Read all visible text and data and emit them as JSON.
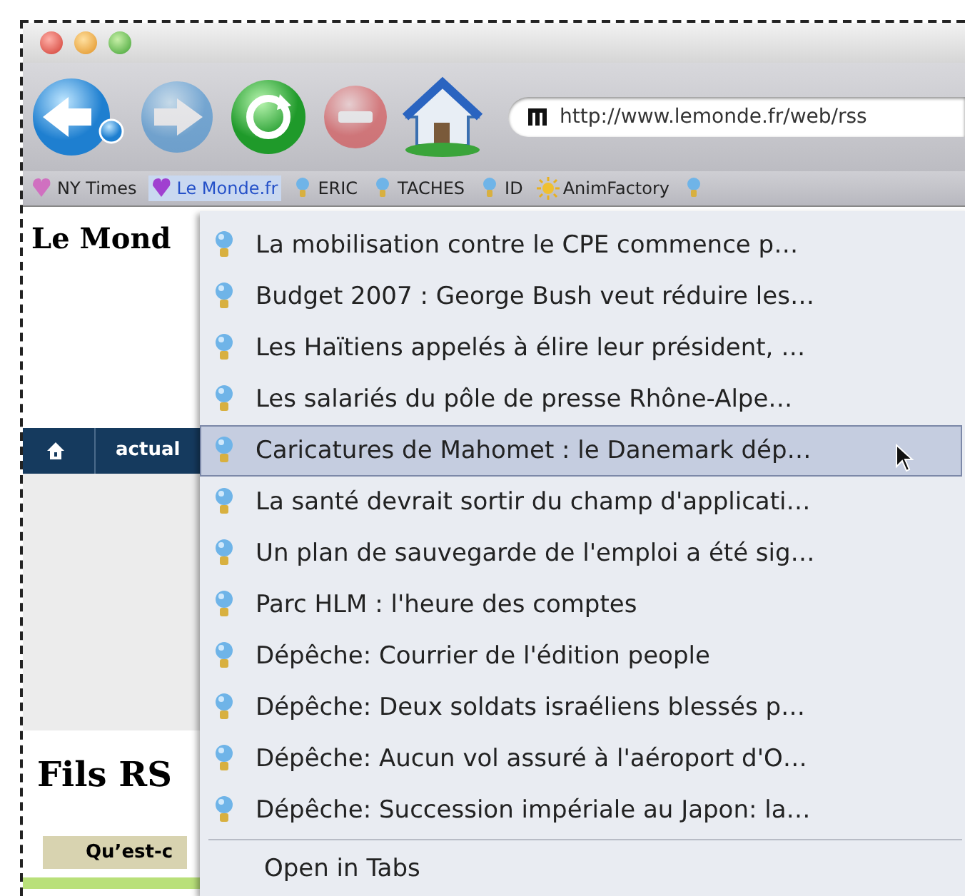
{
  "toolbar": {
    "buttons": [
      {
        "kind": "back",
        "disabled": false
      },
      {
        "kind": "forward",
        "disabled": true
      },
      {
        "kind": "reload",
        "disabled": false
      },
      {
        "kind": "stop",
        "disabled": true
      },
      {
        "kind": "home",
        "disabled": false
      }
    ],
    "url": "http://www.lemonde.fr/web/rss"
  },
  "bookmarks": [
    {
      "label": "NY Times",
      "kind": "heart",
      "selected": false
    },
    {
      "label": "Le Monde.fr",
      "kind": "heart",
      "selected": true
    },
    {
      "label": "ERIC",
      "kind": "feed",
      "selected": false
    },
    {
      "label": "TACHES",
      "kind": "feed",
      "selected": false
    },
    {
      "label": "ID",
      "kind": "feed",
      "selected": false
    },
    {
      "label": "AnimFactory",
      "kind": "sun",
      "selected": false
    },
    {
      "kind": "feed",
      "selected": false
    }
  ],
  "page": {
    "logo": "Le Mond",
    "nav": "actual",
    "heading": "Fils RS",
    "tab": "Qu’est-c"
  },
  "menu": {
    "items": [
      {
        "label": "La mobilisation contre le CPE commence p…",
        "selected": false
      },
      {
        "label": "Budget 2007 : George Bush veut réduire les…",
        "selected": false
      },
      {
        "label": "Les Haïtiens appelés à élire leur président, …",
        "selected": false
      },
      {
        "label": "Les salariés du pôle de presse Rhône-Alpe…",
        "selected": false
      },
      {
        "label": "Caricatures de Mahomet : le Danemark dép…",
        "selected": true
      },
      {
        "label": "La santé devrait sortir du champ d'applicati…",
        "selected": false
      },
      {
        "label": "Un plan de sauvegarde de l'emploi a été sig…",
        "selected": false
      },
      {
        "label": "Parc HLM : l'heure des comptes",
        "selected": false
      },
      {
        "label": "Dépêche: Courrier de l'édition people",
        "selected": false
      },
      {
        "label": "Dépêche: Deux soldats israéliens blessés p…",
        "selected": false
      },
      {
        "label": "Dépêche: Aucun vol assuré à l'aéroport d'O…",
        "selected": false
      },
      {
        "label": "Dépêche: Succession impériale au Japon: la…",
        "selected": false
      }
    ],
    "footer": "Open in Tabs"
  }
}
